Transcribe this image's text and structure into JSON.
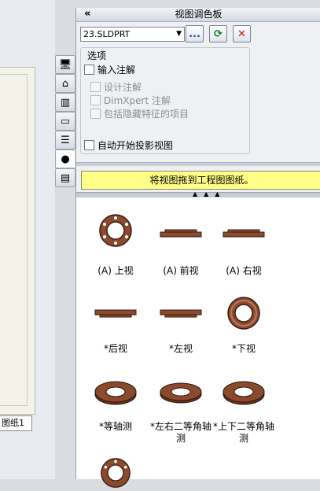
{
  "sheet_tab": "图纸1",
  "palette": {
    "collapse": "«",
    "title": "视图调色板",
    "document": "23.SLDPRT",
    "browse_label": "...",
    "refresh_label": "⟳",
    "close_label": "✕"
  },
  "options": {
    "legend": "选项",
    "import_annotations": "输入注解",
    "design_annotations": "设计注解",
    "dimxpert_annotations": "DimXpert 注解",
    "hidden_features": "包括隐藏特征的项目",
    "auto_projected": "自动开始投影视图"
  },
  "drag_hint": "将视图拖到工程图图纸。",
  "views": [
    {
      "label": "(A) 上视",
      "shape": "ring-flat"
    },
    {
      "label": "(A) 前视",
      "shape": "bar"
    },
    {
      "label": "(A) 右视",
      "shape": "bar"
    },
    {
      "label": "*后视",
      "shape": "bar"
    },
    {
      "label": "*左视",
      "shape": "bar"
    },
    {
      "label": "*下视",
      "shape": "ring-round"
    },
    {
      "label": "*等轴测",
      "shape": "iso"
    },
    {
      "label": "*左右二等角轴测",
      "shape": "iso"
    },
    {
      "label": "*上下二等角轴测",
      "shape": "iso"
    },
    {
      "label": "",
      "shape": "ring-flat"
    }
  ],
  "tab_icons": [
    "monitor-icon",
    "home-icon",
    "library-icon",
    "folder-icon",
    "list-icon",
    "color-wheel-icon",
    "clipboard-icon"
  ],
  "colors": {
    "part": "#8a4a2e",
    "highlight": "#ffff88",
    "accent": "#0a7a2a",
    "danger": "#d01010"
  }
}
